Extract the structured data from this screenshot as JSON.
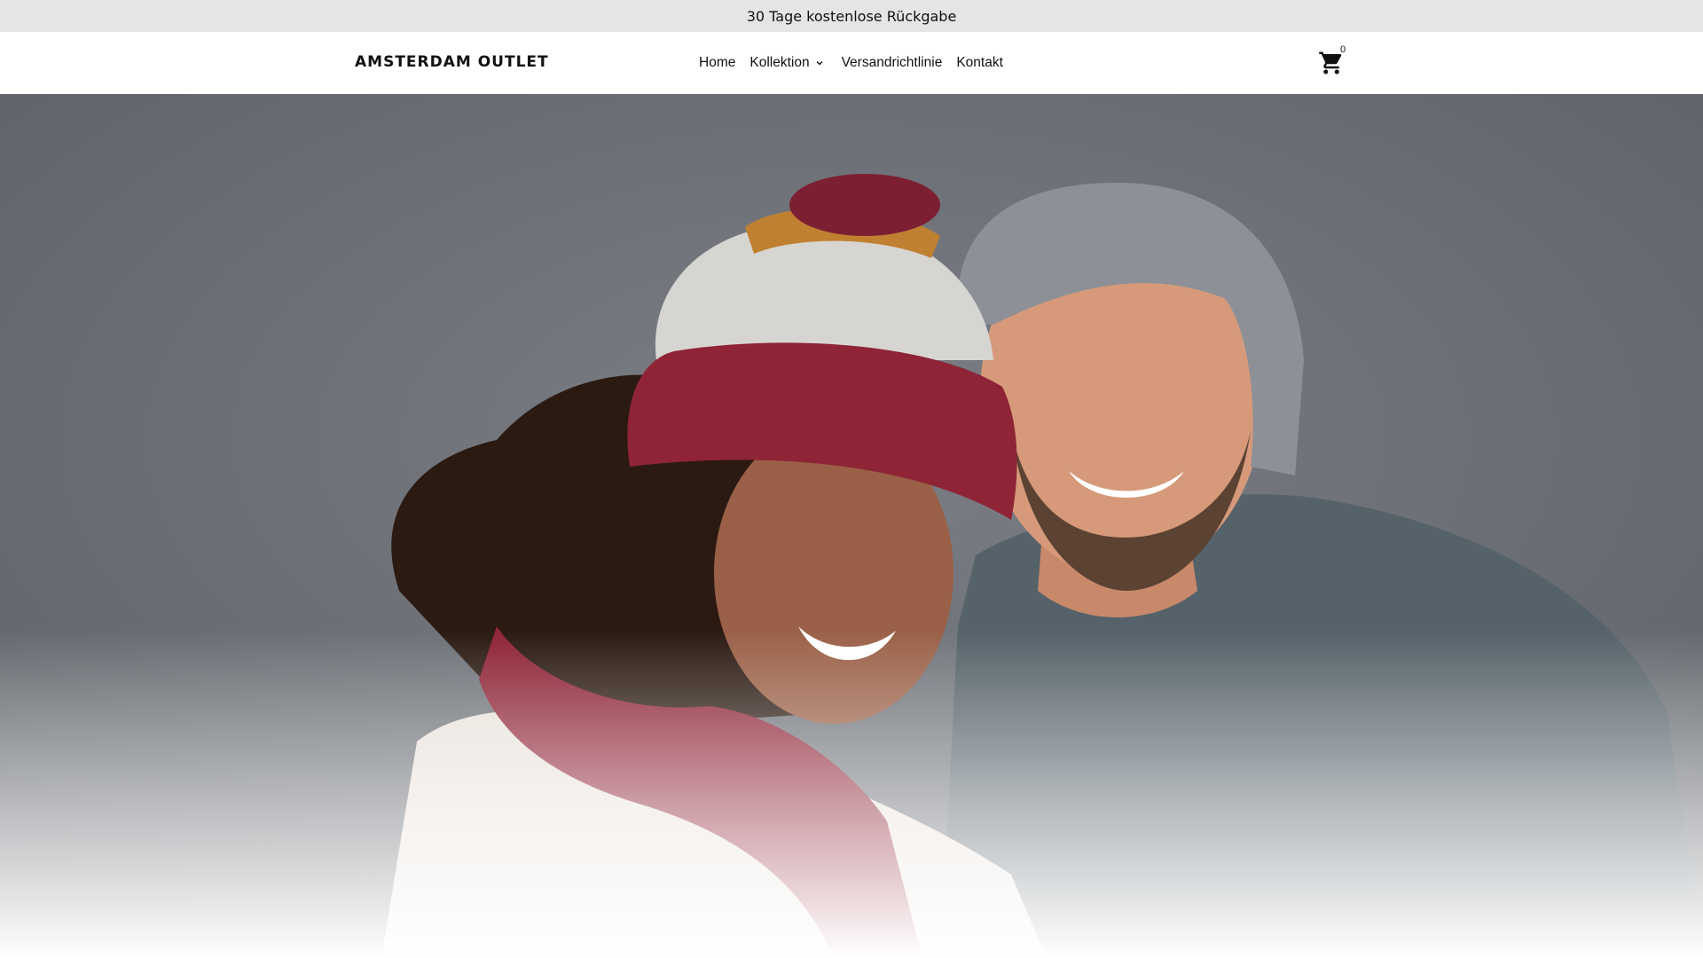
{
  "announcement": {
    "text": "30 Tage kostenlose Rückgabe"
  },
  "header": {
    "logo": "AMSTERDAM OUTLET",
    "nav": {
      "home": "Home",
      "kollektion": "Kollektion",
      "versand": "Versandrichtlinie",
      "kontakt": "Kontakt"
    },
    "cart": {
      "icon": "shopping-cart-icon",
      "count": "0"
    }
  },
  "hero": {
    "image": "smiling couple in knit winter hats and sweaters against grey wall",
    "colors": {
      "wall": "#6f7378",
      "hat_red": "#8e2436",
      "sweater_cream": "#e9e1da",
      "sweater_grey": "#59646a"
    }
  }
}
